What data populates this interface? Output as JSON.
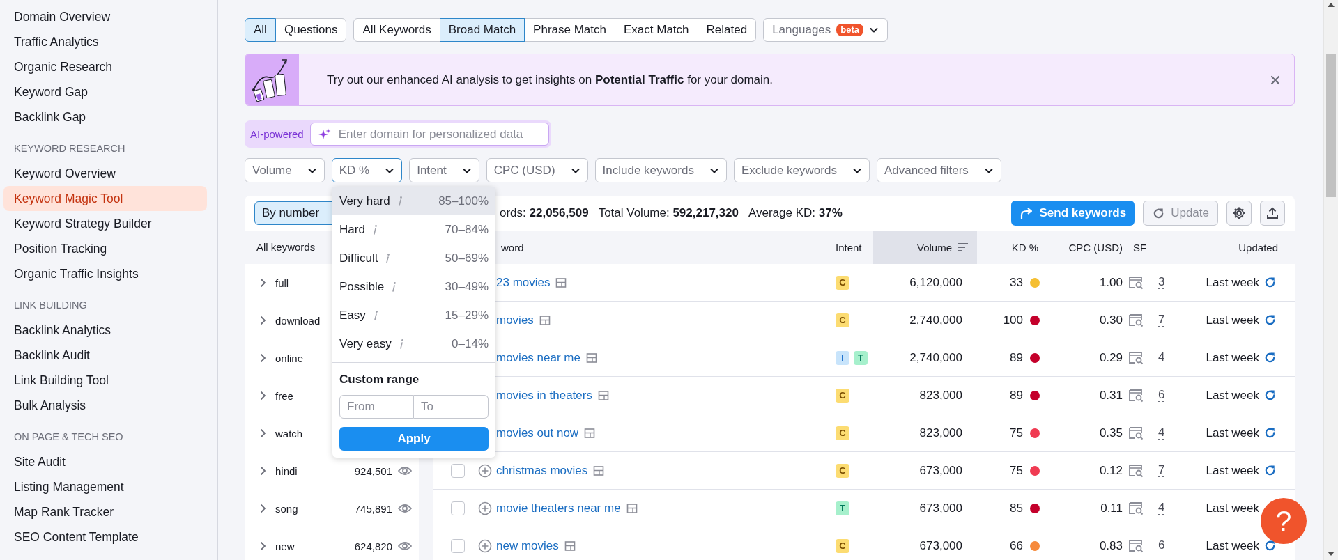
{
  "sidebar": {
    "sections": [
      {
        "items": [
          {
            "label": "Domain Overview",
            "selected": false
          },
          {
            "label": "Traffic Analytics",
            "selected": false
          },
          {
            "label": "Organic Research",
            "selected": false
          },
          {
            "label": "Keyword Gap",
            "selected": false
          },
          {
            "label": "Backlink Gap",
            "selected": false
          }
        ]
      },
      {
        "heading": "KEYWORD RESEARCH",
        "items": [
          {
            "label": "Keyword Overview",
            "selected": false
          },
          {
            "label": "Keyword Magic Tool",
            "selected": true
          },
          {
            "label": "Keyword Strategy Builder",
            "selected": false
          },
          {
            "label": "Position Tracking",
            "selected": false
          },
          {
            "label": "Organic Traffic Insights",
            "selected": false
          }
        ]
      },
      {
        "heading": "LINK BUILDING",
        "items": [
          {
            "label": "Backlink Analytics",
            "selected": false
          },
          {
            "label": "Backlink Audit",
            "selected": false
          },
          {
            "label": "Link Building Tool",
            "selected": false
          },
          {
            "label": "Bulk Analysis",
            "selected": false
          }
        ]
      },
      {
        "heading": "ON PAGE & TECH SEO",
        "items": [
          {
            "label": "Site Audit",
            "selected": false
          },
          {
            "label": "Listing Management",
            "selected": false
          },
          {
            "label": "Map Rank Tracker",
            "selected": false
          },
          {
            "label": "SEO Content Template",
            "selected": false
          }
        ]
      }
    ]
  },
  "question_tabs": [
    {
      "label": "All",
      "selected": true
    },
    {
      "label": "Questions",
      "selected": false
    }
  ],
  "match_tabs": [
    {
      "label": "All Keywords",
      "selected": false
    },
    {
      "label": "Broad Match",
      "selected": true
    },
    {
      "label": "Phrase Match",
      "selected": false
    },
    {
      "label": "Exact Match",
      "selected": false
    },
    {
      "label": "Related",
      "selected": false
    }
  ],
  "languages": {
    "label": "Languages",
    "badge": "beta"
  },
  "banner": {
    "text": "Try out our enhanced AI analysis to get insights on **Potential Traffic** for your domain."
  },
  "ai_search": {
    "label": "AI-powered",
    "placeholder": "Enter domain for personalized data"
  },
  "filters": [
    {
      "label": "Volume",
      "open": false
    },
    {
      "label": "KD %",
      "open": true
    },
    {
      "label": "Intent",
      "open": false
    },
    {
      "label": "CPC (USD)",
      "open": false
    },
    {
      "label": "Include keywords",
      "open": false
    },
    {
      "label": "Exclude keywords",
      "open": false
    },
    {
      "label": "Advanced filters",
      "open": false
    }
  ],
  "card": {
    "group_button": "By number",
    "stats": [
      {
        "label": "ords:",
        "value": "22,056,509"
      },
      {
        "label": "Total Volume:",
        "value": "592,217,320"
      },
      {
        "label": "Average KD:",
        "value": "37%"
      }
    ],
    "send_button": "Send keywords",
    "update_button": {
      "label": "Update",
      "disabled": true
    }
  },
  "groups": {
    "header": "All keywords",
    "items": [
      {
        "word": "full"
      },
      {
        "word": "download"
      },
      {
        "word": "online"
      },
      {
        "word": "free"
      },
      {
        "word": "watch"
      },
      {
        "word": "hindi",
        "count": "924,501"
      },
      {
        "word": "song",
        "count": "745,891"
      },
      {
        "word": "new",
        "count": "624,820"
      }
    ]
  },
  "table": {
    "columns": [
      {
        "label": "word",
        "sorted": false
      },
      {
        "label": "Intent",
        "sorted": false
      },
      {
        "label": "Volume",
        "sorted": true
      },
      {
        "label": "KD %",
        "sorted": false
      },
      {
        "label": "CPC (USD)",
        "sorted": false
      },
      {
        "label": "SF",
        "sorted": false
      },
      {
        "label": "Updated",
        "sorted": false
      }
    ],
    "rows": [
      {
        "kind": "covered",
        "keyword": "23 movies",
        "intents": [
          {
            "kind": "commercial",
            "label": "C"
          }
        ],
        "volume": "6,120,000",
        "kd": "33",
        "color": "#f5bf32",
        "cpc": "1.00",
        "sf": "3",
        "updated": "Last week",
        "refresh_icon": true
      },
      {
        "kind": "covered",
        "keyword": "movies",
        "intents": [
          {
            "kind": "commercial",
            "label": "C"
          }
        ],
        "volume": "2,740,000",
        "kd": "100",
        "color": "#c4002b",
        "cpc": "0.30",
        "sf": "7",
        "updated": "Last week",
        "refresh_icon": true
      },
      {
        "kind": "covered",
        "keyword": "movies near me",
        "intents": [
          {
            "kind": "informational",
            "label": "I"
          },
          {
            "kind": "transactional",
            "label": "T"
          }
        ],
        "volume": "2,740,000",
        "kd": "89",
        "color": "#c4002b",
        "cpc": "0.29",
        "sf": "4",
        "updated": "Last week",
        "refresh_icon": true
      },
      {
        "kind": "covered",
        "keyword": "movies in theaters",
        "intents": [
          {
            "kind": "commercial",
            "label": "C"
          }
        ],
        "volume": "823,000",
        "kd": "89",
        "color": "#c4002b",
        "cpc": "0.31",
        "sf": "6",
        "updated": "Last week",
        "refresh_icon": true
      },
      {
        "kind": "covered",
        "keyword": "movies out now",
        "intents": [
          {
            "kind": "commercial",
            "label": "C"
          }
        ],
        "volume": "823,000",
        "kd": "75",
        "color": "#f03b52",
        "cpc": "0.35",
        "sf": "4",
        "updated": "Last week",
        "refresh_icon": true
      },
      {
        "kind": "full",
        "checked": false,
        "keyword": "christmas movies",
        "intents": [
          {
            "kind": "commercial",
            "label": "C"
          }
        ],
        "volume": "673,000",
        "kd": "75",
        "color": "#f03b52",
        "cpc": "0.12",
        "sf": "7",
        "updated": "Last week",
        "refresh_icon": true
      },
      {
        "kind": "full",
        "checked": false,
        "keyword": "movie theaters near me",
        "intents": [
          {
            "kind": "transactional",
            "label": "T"
          }
        ],
        "volume": "673,000",
        "kd": "85",
        "color": "#c4002b",
        "cpc": "0.11",
        "sf": "4",
        "updated": "Last week",
        "refresh_icon": false
      },
      {
        "kind": "full",
        "checked": false,
        "keyword": "new movies",
        "intents": [
          {
            "kind": "commercial",
            "label": "C"
          }
        ],
        "volume": "673,000",
        "kd": "66",
        "color": "#f68a3c",
        "cpc": "0.83",
        "sf": "6",
        "updated": "Last week",
        "refresh_icon": true
      }
    ]
  },
  "kd_menu": {
    "options": [
      {
        "label": "Very hard",
        "range": "85–100%",
        "selected": true
      },
      {
        "label": "Hard",
        "range": "70–84%",
        "selected": false
      },
      {
        "label": "Difficult",
        "range": "50–69%",
        "selected": false
      },
      {
        "label": "Possible",
        "range": "30–49%",
        "selected": false
      },
      {
        "label": "Easy",
        "range": "15–29%",
        "selected": false
      },
      {
        "label": "Very easy",
        "range": "0–14%",
        "selected": false
      }
    ],
    "custom_heading": "Custom range",
    "from_placeholder": "From",
    "to_placeholder": "To",
    "apply": "Apply"
  },
  "help": {
    "label": "?"
  }
}
